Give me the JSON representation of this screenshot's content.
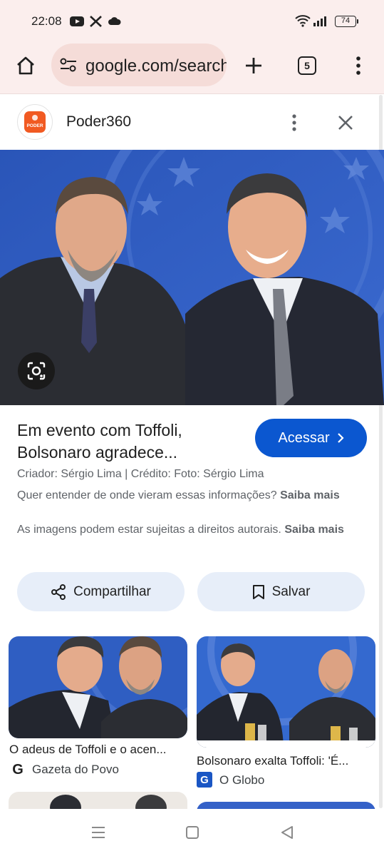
{
  "status_bar": {
    "time": "22:08",
    "battery": "74"
  },
  "browser": {
    "url": "google.com/search",
    "tab_count": "5"
  },
  "source": {
    "name": "Poder360",
    "logo_text": "PODER"
  },
  "result": {
    "title_line1": "Em evento com Toffoli,",
    "title_line2": "Bolsonaro agradece...",
    "visit_label": "Acessar",
    "meta": "Criador: Sérgio Lima | Crédito: Foto: Sérgio Lima",
    "info_question": "Quer entender de onde vieram essas informações?",
    "info_link": "Saiba mais",
    "copyright_text": "As imagens podem estar sujeitas a direitos autorais.",
    "copyright_link": "Saiba mais"
  },
  "actions": {
    "share_label": "Compartilhar",
    "save_label": "Salvar"
  },
  "related": [
    {
      "caption": "O adeus de Toffoli e o acen...",
      "source": "Gazeta do Povo",
      "favicon": "G"
    },
    {
      "caption": "Bolsonaro exalta Toffoli: 'É...",
      "source": "O Globo",
      "favicon": "G"
    }
  ],
  "colors": {
    "accent": "#0b57d0",
    "toolbar_bg": "#fbeeed",
    "chip_bg": "#e7eef9",
    "poder_orange": "#f15a22"
  }
}
